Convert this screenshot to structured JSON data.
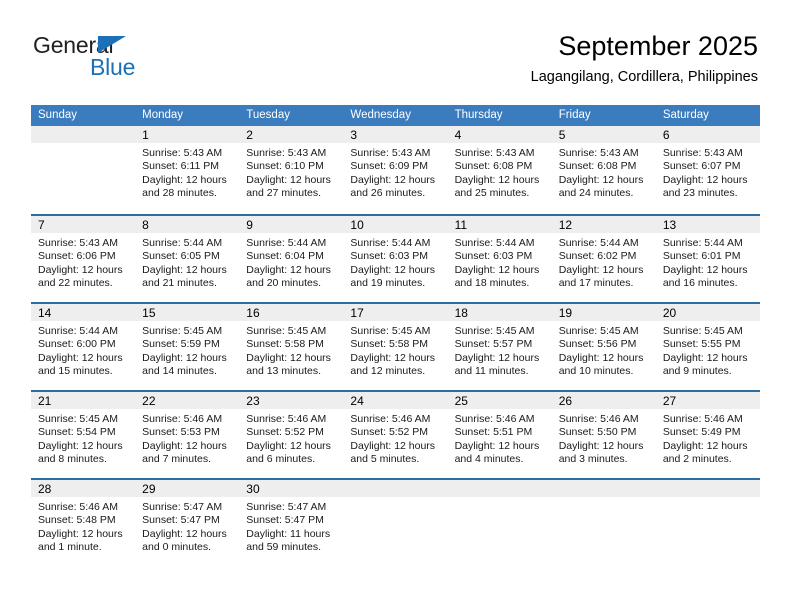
{
  "brand": {
    "name_dark": "General",
    "name_blue": "Blue",
    "triangle_icon": "triangle-icon",
    "accent_color": "#1c70b8"
  },
  "header": {
    "title": "September 2025",
    "location": "Lagangilang, Cordillera, Philippines"
  },
  "colors": {
    "header_blue": "#3b7cbe",
    "week_separator": "#2e6da4",
    "daynum_band": "#eeeeee"
  },
  "weekday_headers": [
    "Sunday",
    "Monday",
    "Tuesday",
    "Wednesday",
    "Thursday",
    "Friday",
    "Saturday"
  ],
  "weeks": [
    [
      {
        "day": "",
        "sunrise": "",
        "sunset": "",
        "daylight1": "",
        "daylight2": ""
      },
      {
        "day": "1",
        "sunrise": "Sunrise: 5:43 AM",
        "sunset": "Sunset: 6:11 PM",
        "daylight1": "Daylight: 12 hours",
        "daylight2": "and 28 minutes."
      },
      {
        "day": "2",
        "sunrise": "Sunrise: 5:43 AM",
        "sunset": "Sunset: 6:10 PM",
        "daylight1": "Daylight: 12 hours",
        "daylight2": "and 27 minutes."
      },
      {
        "day": "3",
        "sunrise": "Sunrise: 5:43 AM",
        "sunset": "Sunset: 6:09 PM",
        "daylight1": "Daylight: 12 hours",
        "daylight2": "and 26 minutes."
      },
      {
        "day": "4",
        "sunrise": "Sunrise: 5:43 AM",
        "sunset": "Sunset: 6:08 PM",
        "daylight1": "Daylight: 12 hours",
        "daylight2": "and 25 minutes."
      },
      {
        "day": "5",
        "sunrise": "Sunrise: 5:43 AM",
        "sunset": "Sunset: 6:08 PM",
        "daylight1": "Daylight: 12 hours",
        "daylight2": "and 24 minutes."
      },
      {
        "day": "6",
        "sunrise": "Sunrise: 5:43 AM",
        "sunset": "Sunset: 6:07 PM",
        "daylight1": "Daylight: 12 hours",
        "daylight2": "and 23 minutes."
      }
    ],
    [
      {
        "day": "7",
        "sunrise": "Sunrise: 5:43 AM",
        "sunset": "Sunset: 6:06 PM",
        "daylight1": "Daylight: 12 hours",
        "daylight2": "and 22 minutes."
      },
      {
        "day": "8",
        "sunrise": "Sunrise: 5:44 AM",
        "sunset": "Sunset: 6:05 PM",
        "daylight1": "Daylight: 12 hours",
        "daylight2": "and 21 minutes."
      },
      {
        "day": "9",
        "sunrise": "Sunrise: 5:44 AM",
        "sunset": "Sunset: 6:04 PM",
        "daylight1": "Daylight: 12 hours",
        "daylight2": "and 20 minutes."
      },
      {
        "day": "10",
        "sunrise": "Sunrise: 5:44 AM",
        "sunset": "Sunset: 6:03 PM",
        "daylight1": "Daylight: 12 hours",
        "daylight2": "and 19 minutes."
      },
      {
        "day": "11",
        "sunrise": "Sunrise: 5:44 AM",
        "sunset": "Sunset: 6:03 PM",
        "daylight1": "Daylight: 12 hours",
        "daylight2": "and 18 minutes."
      },
      {
        "day": "12",
        "sunrise": "Sunrise: 5:44 AM",
        "sunset": "Sunset: 6:02 PM",
        "daylight1": "Daylight: 12 hours",
        "daylight2": "and 17 minutes."
      },
      {
        "day": "13",
        "sunrise": "Sunrise: 5:44 AM",
        "sunset": "Sunset: 6:01 PM",
        "daylight1": "Daylight: 12 hours",
        "daylight2": "and 16 minutes."
      }
    ],
    [
      {
        "day": "14",
        "sunrise": "Sunrise: 5:44 AM",
        "sunset": "Sunset: 6:00 PM",
        "daylight1": "Daylight: 12 hours",
        "daylight2": "and 15 minutes."
      },
      {
        "day": "15",
        "sunrise": "Sunrise: 5:45 AM",
        "sunset": "Sunset: 5:59 PM",
        "daylight1": "Daylight: 12 hours",
        "daylight2": "and 14 minutes."
      },
      {
        "day": "16",
        "sunrise": "Sunrise: 5:45 AM",
        "sunset": "Sunset: 5:58 PM",
        "daylight1": "Daylight: 12 hours",
        "daylight2": "and 13 minutes."
      },
      {
        "day": "17",
        "sunrise": "Sunrise: 5:45 AM",
        "sunset": "Sunset: 5:58 PM",
        "daylight1": "Daylight: 12 hours",
        "daylight2": "and 12 minutes."
      },
      {
        "day": "18",
        "sunrise": "Sunrise: 5:45 AM",
        "sunset": "Sunset: 5:57 PM",
        "daylight1": "Daylight: 12 hours",
        "daylight2": "and 11 minutes."
      },
      {
        "day": "19",
        "sunrise": "Sunrise: 5:45 AM",
        "sunset": "Sunset: 5:56 PM",
        "daylight1": "Daylight: 12 hours",
        "daylight2": "and 10 minutes."
      },
      {
        "day": "20",
        "sunrise": "Sunrise: 5:45 AM",
        "sunset": "Sunset: 5:55 PM",
        "daylight1": "Daylight: 12 hours",
        "daylight2": "and 9 minutes."
      }
    ],
    [
      {
        "day": "21",
        "sunrise": "Sunrise: 5:45 AM",
        "sunset": "Sunset: 5:54 PM",
        "daylight1": "Daylight: 12 hours",
        "daylight2": "and 8 minutes."
      },
      {
        "day": "22",
        "sunrise": "Sunrise: 5:46 AM",
        "sunset": "Sunset: 5:53 PM",
        "daylight1": "Daylight: 12 hours",
        "daylight2": "and 7 minutes."
      },
      {
        "day": "23",
        "sunrise": "Sunrise: 5:46 AM",
        "sunset": "Sunset: 5:52 PM",
        "daylight1": "Daylight: 12 hours",
        "daylight2": "and 6 minutes."
      },
      {
        "day": "24",
        "sunrise": "Sunrise: 5:46 AM",
        "sunset": "Sunset: 5:52 PM",
        "daylight1": "Daylight: 12 hours",
        "daylight2": "and 5 minutes."
      },
      {
        "day": "25",
        "sunrise": "Sunrise: 5:46 AM",
        "sunset": "Sunset: 5:51 PM",
        "daylight1": "Daylight: 12 hours",
        "daylight2": "and 4 minutes."
      },
      {
        "day": "26",
        "sunrise": "Sunrise: 5:46 AM",
        "sunset": "Sunset: 5:50 PM",
        "daylight1": "Daylight: 12 hours",
        "daylight2": "and 3 minutes."
      },
      {
        "day": "27",
        "sunrise": "Sunrise: 5:46 AM",
        "sunset": "Sunset: 5:49 PM",
        "daylight1": "Daylight: 12 hours",
        "daylight2": "and 2 minutes."
      }
    ],
    [
      {
        "day": "28",
        "sunrise": "Sunrise: 5:46 AM",
        "sunset": "Sunset: 5:48 PM",
        "daylight1": "Daylight: 12 hours",
        "daylight2": "and 1 minute."
      },
      {
        "day": "29",
        "sunrise": "Sunrise: 5:47 AM",
        "sunset": "Sunset: 5:47 PM",
        "daylight1": "Daylight: 12 hours",
        "daylight2": "and 0 minutes."
      },
      {
        "day": "30",
        "sunrise": "Sunrise: 5:47 AM",
        "sunset": "Sunset: 5:47 PM",
        "daylight1": "Daylight: 11 hours",
        "daylight2": "and 59 minutes."
      },
      {
        "day": "",
        "sunrise": "",
        "sunset": "",
        "daylight1": "",
        "daylight2": ""
      },
      {
        "day": "",
        "sunrise": "",
        "sunset": "",
        "daylight1": "",
        "daylight2": ""
      },
      {
        "day": "",
        "sunrise": "",
        "sunset": "",
        "daylight1": "",
        "daylight2": ""
      },
      {
        "day": "",
        "sunrise": "",
        "sunset": "",
        "daylight1": "",
        "daylight2": ""
      }
    ]
  ]
}
